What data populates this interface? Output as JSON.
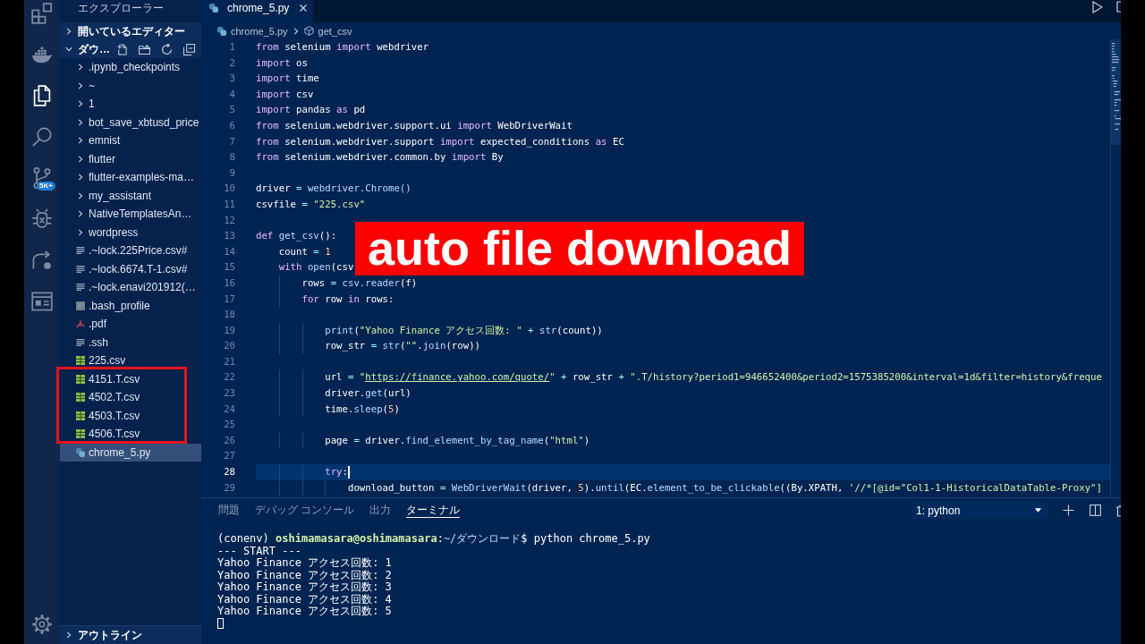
{
  "activity_bar": {
    "items": [
      {
        "kind": "extensions",
        "selected": false
      },
      {
        "kind": "docker",
        "selected": false
      },
      {
        "kind": "explorer",
        "selected": true
      },
      {
        "kind": "search",
        "selected": false
      },
      {
        "kind": "scm",
        "selected": false,
        "badge": "5K+"
      },
      {
        "kind": "debug",
        "selected": false
      },
      {
        "kind": "share",
        "selected": false
      },
      {
        "kind": "preview",
        "selected": false
      }
    ]
  },
  "sidebar": {
    "title": "エクスプローラー",
    "sections": [
      {
        "label": "開いているエディター",
        "expanded": false
      },
      {
        "label": "ダウ…",
        "expanded": true
      }
    ],
    "tree": [
      {
        "name": ".ipynb_checkpoints",
        "kind": "folder",
        "selected": false
      },
      {
        "name": "~",
        "kind": "folder",
        "selected": false
      },
      {
        "name": "1",
        "kind": "folder",
        "selected": false
      },
      {
        "name": "bot_save_xbtusd_price",
        "kind": "folder",
        "selected": false
      },
      {
        "name": "emnist",
        "kind": "folder",
        "selected": false
      },
      {
        "name": "flutter",
        "kind": "folder",
        "selected": false
      },
      {
        "name": "flutter-examples-ma…",
        "kind": "folder",
        "selected": false
      },
      {
        "name": "my_assistant",
        "kind": "folder",
        "selected": false
      },
      {
        "name": "NativeTemplatesAn…",
        "kind": "folder",
        "selected": false
      },
      {
        "name": "wordpress",
        "kind": "folder",
        "selected": false
      },
      {
        "name": ".~lock.225Price.csv#",
        "kind": "lines",
        "selected": false
      },
      {
        "name": ".~lock.6674.T-1.csv#",
        "kind": "lines",
        "selected": false
      },
      {
        "name": ".~lock.enavi201912(…",
        "kind": "lines",
        "selected": false
      },
      {
        "name": ".bash_profile",
        "kind": "square",
        "selected": false
      },
      {
        "name": ".pdf",
        "kind": "pdf",
        "selected": false
      },
      {
        "name": ".ssh",
        "kind": "lines",
        "selected": false
      },
      {
        "name": "225.csv",
        "kind": "table",
        "selected": false
      },
      {
        "name": "4151.T.csv",
        "kind": "table",
        "selected": false
      },
      {
        "name": "4502.T.csv",
        "kind": "table",
        "selected": false
      },
      {
        "name": "4503.T.csv",
        "kind": "table",
        "selected": false
      },
      {
        "name": "4506.T.csv",
        "kind": "table",
        "selected": false
      },
      {
        "name": "chrome_5.py",
        "kind": "python",
        "selected": true
      }
    ],
    "outline": {
      "label": "アウトライン",
      "expanded": false
    }
  },
  "editor": {
    "tabs": [
      {
        "label": "chrome_5.py",
        "selected": true
      }
    ],
    "breadcrumb": [
      {
        "label": "chrome_5.py",
        "kind": "file"
      },
      {
        "label": "get_csv",
        "kind": "symbol"
      }
    ],
    "lines": [
      {
        "number": "1",
        "current": false,
        "tokens": [
          {
            "text": "from",
            "kind": "kw"
          },
          {
            "text": " selenium ",
            "kind": "plain"
          },
          {
            "text": "import",
            "kind": "kw"
          },
          {
            "text": " webdriver",
            "kind": "plain"
          }
        ]
      },
      {
        "number": "2",
        "current": false,
        "tokens": [
          {
            "text": "import",
            "kind": "kw"
          },
          {
            "text": " os",
            "kind": "plain"
          }
        ]
      },
      {
        "number": "3",
        "current": false,
        "tokens": [
          {
            "text": "import",
            "kind": "kw"
          },
          {
            "text": " time",
            "kind": "plain"
          }
        ]
      },
      {
        "number": "4",
        "current": false,
        "tokens": [
          {
            "text": "import",
            "kind": "kw"
          },
          {
            "text": " csv",
            "kind": "plain"
          }
        ]
      },
      {
        "number": "5",
        "current": false,
        "tokens": [
          {
            "text": "import",
            "kind": "kw"
          },
          {
            "text": " pandas ",
            "kind": "plain"
          },
          {
            "text": "as",
            "kind": "kw"
          },
          {
            "text": " pd",
            "kind": "plain"
          }
        ]
      },
      {
        "number": "6",
        "current": false,
        "tokens": [
          {
            "text": "from",
            "kind": "kw"
          },
          {
            "text": " selenium.webdriver.support.ui ",
            "kind": "plain"
          },
          {
            "text": "import",
            "kind": "kw"
          },
          {
            "text": " WebDriverWait",
            "kind": "plain"
          }
        ]
      },
      {
        "number": "7",
        "current": false,
        "tokens": [
          {
            "text": "from",
            "kind": "kw"
          },
          {
            "text": " selenium.webdriver.support ",
            "kind": "plain"
          },
          {
            "text": "import",
            "kind": "kw"
          },
          {
            "text": " expected_conditions ",
            "kind": "plain"
          },
          {
            "text": "as",
            "kind": "kw"
          },
          {
            "text": " EC",
            "kind": "plain"
          }
        ]
      },
      {
        "number": "8",
        "current": false,
        "tokens": [
          {
            "text": "from",
            "kind": "kw"
          },
          {
            "text": " selenium.webdriver.common.by ",
            "kind": "plain"
          },
          {
            "text": "import",
            "kind": "kw"
          },
          {
            "text": " By",
            "kind": "plain"
          }
        ]
      },
      {
        "number": "9",
        "current": false
      },
      {
        "number": "10",
        "current": false,
        "tokens": [
          {
            "text": "driver ",
            "kind": "plain"
          },
          {
            "text": "= ",
            "kind": "op"
          },
          {
            "text": "webdriver.Chrome()",
            "kind": "fn"
          }
        ]
      },
      {
        "number": "11",
        "current": false,
        "tokens": [
          {
            "text": "csvfile ",
            "kind": "plain"
          },
          {
            "text": "= ",
            "kind": "op"
          },
          {
            "text": "\"225.csv\"",
            "kind": "str"
          }
        ]
      },
      {
        "number": "12",
        "current": false
      },
      {
        "number": "13",
        "current": false,
        "tokens": [
          {
            "text": "def ",
            "kind": "kw"
          },
          {
            "text": "get_csv",
            "kind": "fn"
          },
          {
            "text": "():",
            "kind": "plain"
          }
        ]
      },
      {
        "number": "14",
        "current": false,
        "tokens": [
          {
            "text": "    count ",
            "kind": "plain"
          },
          {
            "text": "= ",
            "kind": "op"
          },
          {
            "text": "1",
            "kind": "num"
          }
        ]
      },
      {
        "number": "15",
        "current": false,
        "tokens": [
          {
            "text": "    with ",
            "kind": "kw"
          },
          {
            "text": "open",
            "kind": "fn"
          },
          {
            "text": "(csv",
            "kind": "plain"
          }
        ]
      },
      {
        "number": "16",
        "current": false,
        "tokens": [
          {
            "text": "        rows ",
            "kind": "plain"
          },
          {
            "text": "= ",
            "kind": "op"
          },
          {
            "text": "csv.reader",
            "kind": "fn"
          },
          {
            "text": "(f)",
            "kind": "plain"
          }
        ]
      },
      {
        "number": "17",
        "current": false,
        "tokens": [
          {
            "text": "        for",
            "kind": "kw"
          },
          {
            "text": " row ",
            "kind": "plain"
          },
          {
            "text": "in",
            "kind": "kw"
          },
          {
            "text": " rows:",
            "kind": "plain"
          }
        ]
      },
      {
        "number": "18",
        "current": false
      },
      {
        "number": "19",
        "current": false,
        "tokens": [
          {
            "text": "            print",
            "kind": "fn"
          },
          {
            "text": "(",
            "kind": "plain"
          },
          {
            "text": "\"Yahoo Finance アクセス回数: \"",
            "kind": "str"
          },
          {
            "text": " + ",
            "kind": "op"
          },
          {
            "text": "str",
            "kind": "fn"
          },
          {
            "text": "(count))",
            "kind": "plain"
          }
        ]
      },
      {
        "number": "20",
        "current": false,
        "tokens": [
          {
            "text": "            row_str ",
            "kind": "plain"
          },
          {
            "text": "= ",
            "kind": "op"
          },
          {
            "text": "str",
            "kind": "fn"
          },
          {
            "text": "(",
            "kind": "plain"
          },
          {
            "text": "\"\"",
            "kind": "str"
          },
          {
            "text": ".",
            "kind": "plain"
          },
          {
            "text": "join",
            "kind": "fn"
          },
          {
            "text": "(row))",
            "kind": "plain"
          }
        ]
      },
      {
        "number": "21",
        "current": false
      },
      {
        "number": "22",
        "current": false,
        "tokens": [
          {
            "text": "            url ",
            "kind": "plain"
          },
          {
            "text": "= ",
            "kind": "op"
          },
          {
            "text": "\"",
            "kind": "str"
          },
          {
            "text": "https://finance.yahoo.com/quote/",
            "kind": "link"
          },
          {
            "text": "\"",
            "kind": "str"
          },
          {
            "text": " + ",
            "kind": "op"
          },
          {
            "text": "row_str ",
            "kind": "plain"
          },
          {
            "text": "+ ",
            "kind": "op"
          },
          {
            "text": "\".T/history?period1=946652400&period2=1575385200&interval=1d&filter=history&freque",
            "kind": "str"
          }
        ]
      },
      {
        "number": "23",
        "current": false,
        "tokens": [
          {
            "text": "            driver.",
            "kind": "plain"
          },
          {
            "text": "get",
            "kind": "fn"
          },
          {
            "text": "(url)",
            "kind": "plain"
          }
        ]
      },
      {
        "number": "24",
        "current": false,
        "tokens": [
          {
            "text": "            time.",
            "kind": "plain"
          },
          {
            "text": "sleep",
            "kind": "fn"
          },
          {
            "text": "(",
            "kind": "plain"
          },
          {
            "text": "5",
            "kind": "num"
          },
          {
            "text": ")",
            "kind": "plain"
          }
        ]
      },
      {
        "number": "25",
        "current": false
      },
      {
        "number": "26",
        "current": false,
        "tokens": [
          {
            "text": "            page ",
            "kind": "plain"
          },
          {
            "text": "= ",
            "kind": "op"
          },
          {
            "text": "driver.",
            "kind": "plain"
          },
          {
            "text": "find_element_by_tag_name",
            "kind": "fn"
          },
          {
            "text": "(",
            "kind": "plain"
          },
          {
            "text": "\"html\"",
            "kind": "str"
          },
          {
            "text": ")",
            "kind": "plain"
          }
        ]
      },
      {
        "number": "27",
        "current": false
      },
      {
        "number": "28",
        "current": true,
        "tokens": [
          {
            "text": "            try",
            "kind": "kw"
          },
          {
            "text": ":",
            "kind": "plain"
          }
        ]
      },
      {
        "number": "29",
        "current": false,
        "tokens": [
          {
            "text": "                download_button ",
            "kind": "plain"
          },
          {
            "text": "= ",
            "kind": "op"
          },
          {
            "text": "WebDriverWait",
            "kind": "fn"
          },
          {
            "text": "(driver, ",
            "kind": "plain"
          },
          {
            "text": "5",
            "kind": "num"
          },
          {
            "text": ").",
            "kind": "plain"
          },
          {
            "text": "until",
            "kind": "fn"
          },
          {
            "text": "(EC.",
            "kind": "plain"
          },
          {
            "text": "element_to_be_clickable",
            "kind": "fn"
          },
          {
            "text": "((By.XPATH, ",
            "kind": "plain"
          },
          {
            "text": "'//*[@id=\"Col1-1-HistoricalDataTable-Proxy\"]",
            "kind": "str"
          }
        ]
      }
    ]
  },
  "caption": {
    "text": "auto file download"
  },
  "panel": {
    "tabs": [
      {
        "label": "問題",
        "selected": false
      },
      {
        "label": "デバッグ コンソール",
        "selected": false
      },
      {
        "label": "出力",
        "selected": false
      },
      {
        "label": "ターミナル",
        "selected": true
      }
    ],
    "terminal_select": {
      "value": "1: python"
    },
    "terminal_lines": [
      {
        "tokens": [
          {
            "text": "(conenv) ",
            "kind": "plain"
          },
          {
            "text": "oshimamasara@oshimamasara",
            "kind": "user"
          },
          {
            "text": ":",
            "kind": "plain"
          },
          {
            "text": "~/ダウンロード",
            "kind": "path"
          },
          {
            "text": "$ python chrome_5.py",
            "kind": "plain"
          }
        ]
      },
      {
        "tokens": [
          {
            "text": "--- START ---",
            "kind": "plain"
          }
        ]
      },
      {
        "tokens": [
          {
            "text": "Yahoo Finance アクセス回数: 1",
            "kind": "plain"
          }
        ]
      },
      {
        "tokens": [
          {
            "text": "Yahoo Finance アクセス回数: 2",
            "kind": "plain"
          }
        ]
      },
      {
        "tokens": [
          {
            "text": "Yahoo Finance アクセス回数: 3",
            "kind": "plain"
          }
        ]
      },
      {
        "tokens": [
          {
            "text": "Yahoo Finance アクセス回数: 4",
            "kind": "plain"
          }
        ]
      },
      {
        "tokens": [
          {
            "text": "Yahoo Finance アクセス回数: 5",
            "kind": "plain"
          }
        ]
      }
    ]
  }
}
